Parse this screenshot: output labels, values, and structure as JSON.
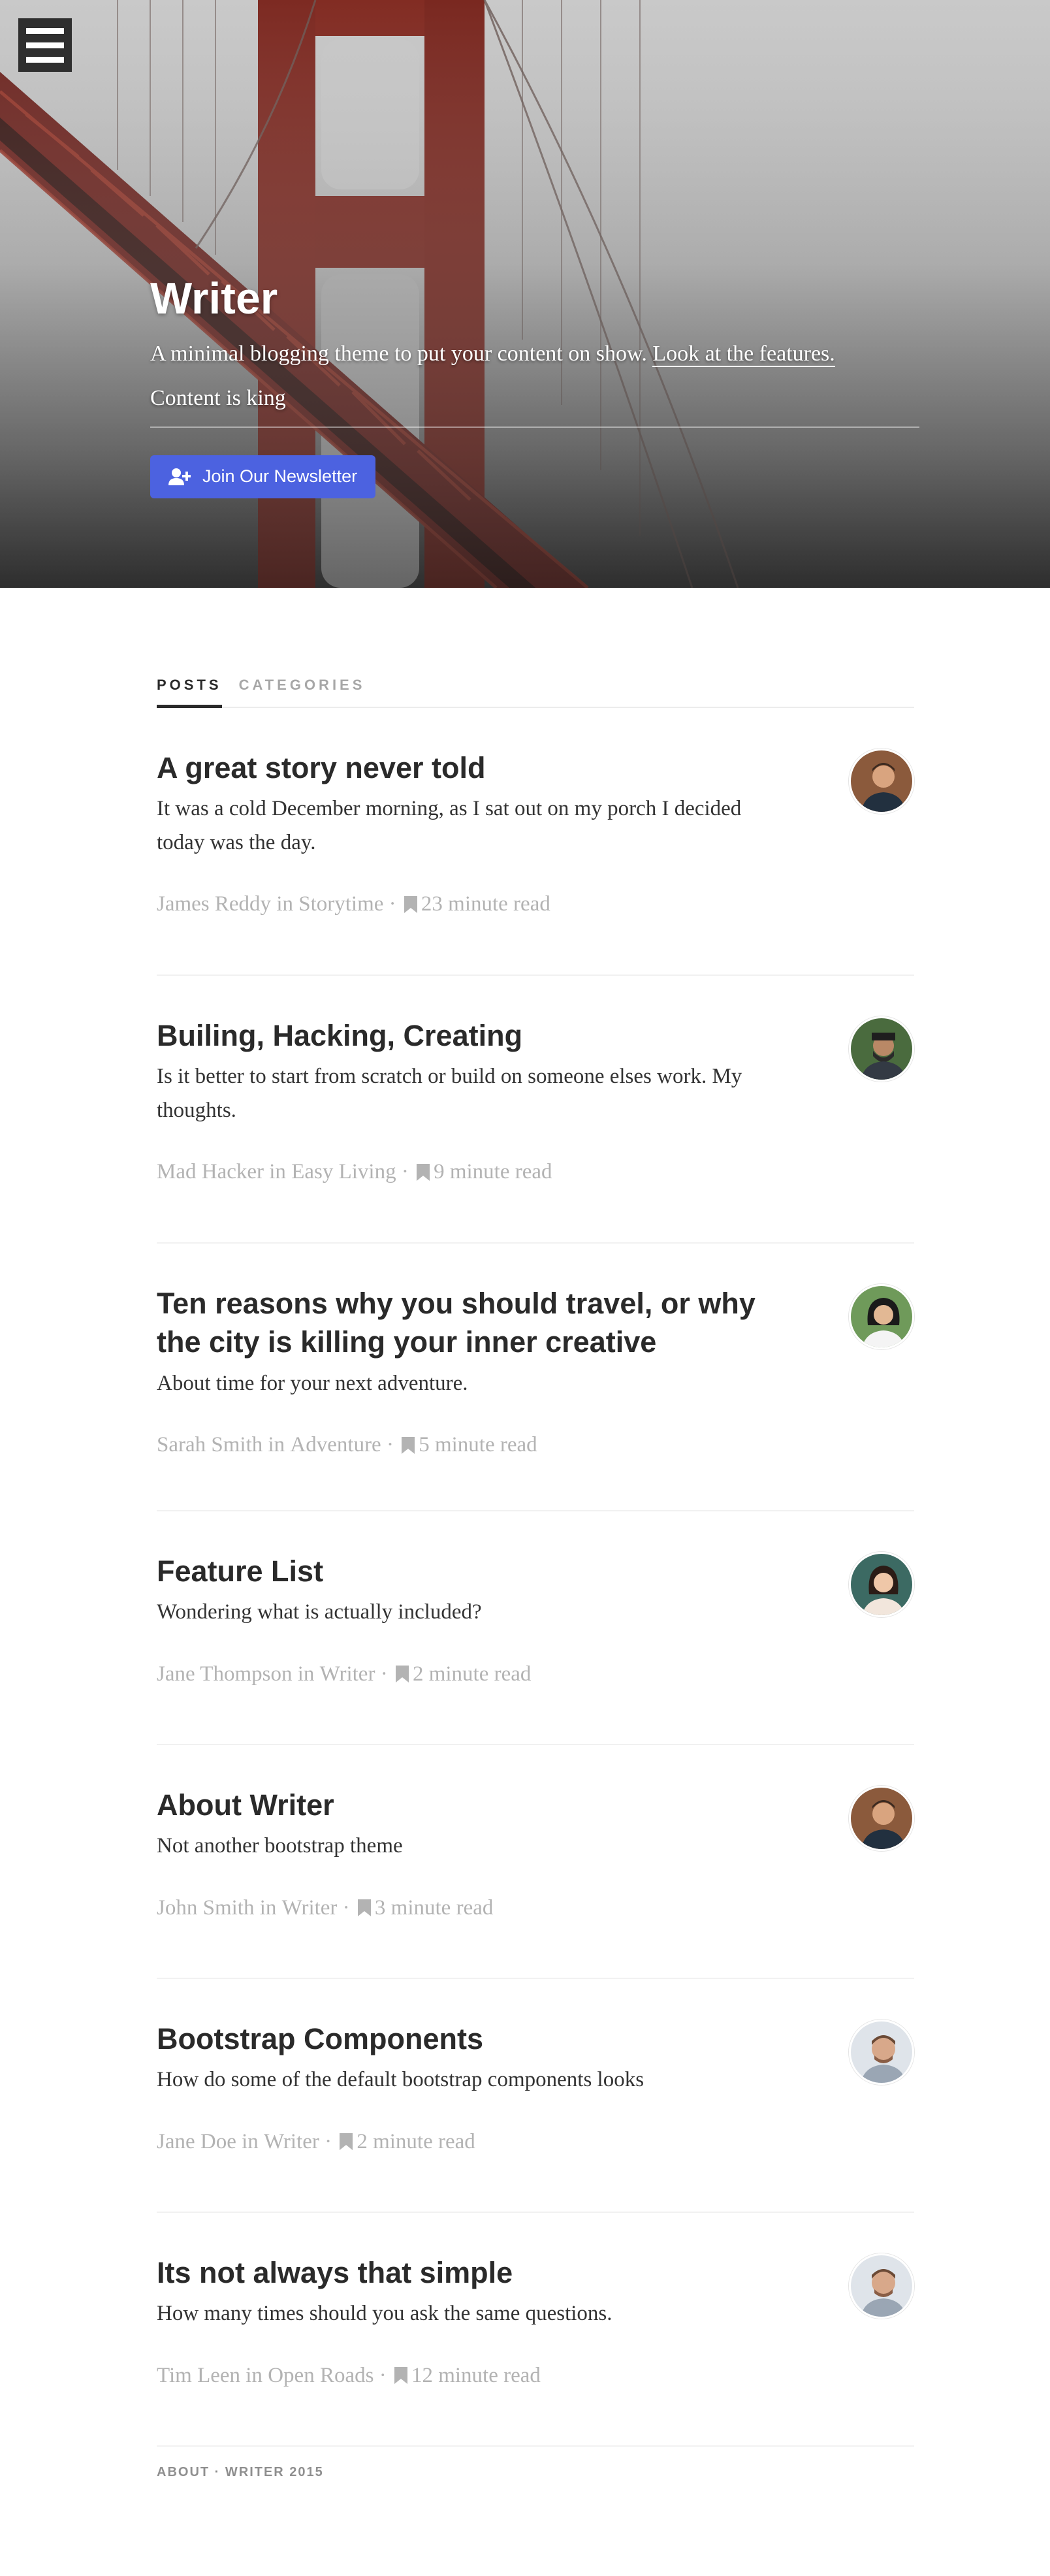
{
  "menu": {
    "icon": "hamburger-icon"
  },
  "hero": {
    "title": "Writer",
    "description": "A minimal blogging theme to put your content on show.",
    "features_link": "Look at the features.",
    "tagline": "Content is king",
    "newsletter_button": "Join Our Newsletter",
    "newsletter_icon": "add-user-icon",
    "button_color": "#4c62e0"
  },
  "tabs": [
    {
      "label": "POSTS",
      "active": true
    },
    {
      "label": "CATEGORIES",
      "active": false
    }
  ],
  "posts": [
    {
      "title": "A great story never told",
      "excerpt": "It was a cold December morning, as I sat out on my porch I decided today was the day.",
      "author": "James Reddy",
      "in": "in",
      "category": "Storytime",
      "separator": "·",
      "read_time": "23 minute read"
    },
    {
      "title": "Builing, Hacking, Creating",
      "excerpt": "Is it better to start from scratch or build on someone elses work. My thoughts.",
      "author": "Mad Hacker",
      "in": "in",
      "category": "Easy Living",
      "separator": "·",
      "read_time": "9 minute read"
    },
    {
      "title": "Ten reasons why you should travel, or why the city is killing your inner creative",
      "excerpt": "About time for your next adventure.",
      "author": "Sarah Smith",
      "in": "in",
      "category": "Adventure",
      "separator": "·",
      "read_time": "5 minute read"
    },
    {
      "title": "Feature List",
      "excerpt": "Wondering what is actually included?",
      "author": "Jane Thompson",
      "in": "in",
      "category": "Writer",
      "separator": "·",
      "read_time": "2 minute read"
    },
    {
      "title": "About Writer",
      "excerpt": "Not another bootstrap theme",
      "author": "John Smith",
      "in": "in",
      "category": "Writer",
      "separator": "·",
      "read_time": "3 minute read"
    },
    {
      "title": "Bootstrap Components",
      "excerpt": "How do some of the default bootstrap components looks",
      "author": "Jane Doe",
      "in": "in",
      "category": "Writer",
      "separator": "·",
      "read_time": "2 minute read"
    },
    {
      "title": "Its not always that simple",
      "excerpt": "How many times should you ask the same questions.",
      "author": "Tim Leen",
      "in": "in",
      "category": "Open Roads",
      "separator": "·",
      "read_time": "12 minute read"
    }
  ],
  "footer": {
    "text": "ABOUT · WRITER 2015"
  },
  "colors": {
    "meta": "#b3b3b3",
    "title": "#2a2a2a",
    "divider": "#f1f1f1"
  }
}
